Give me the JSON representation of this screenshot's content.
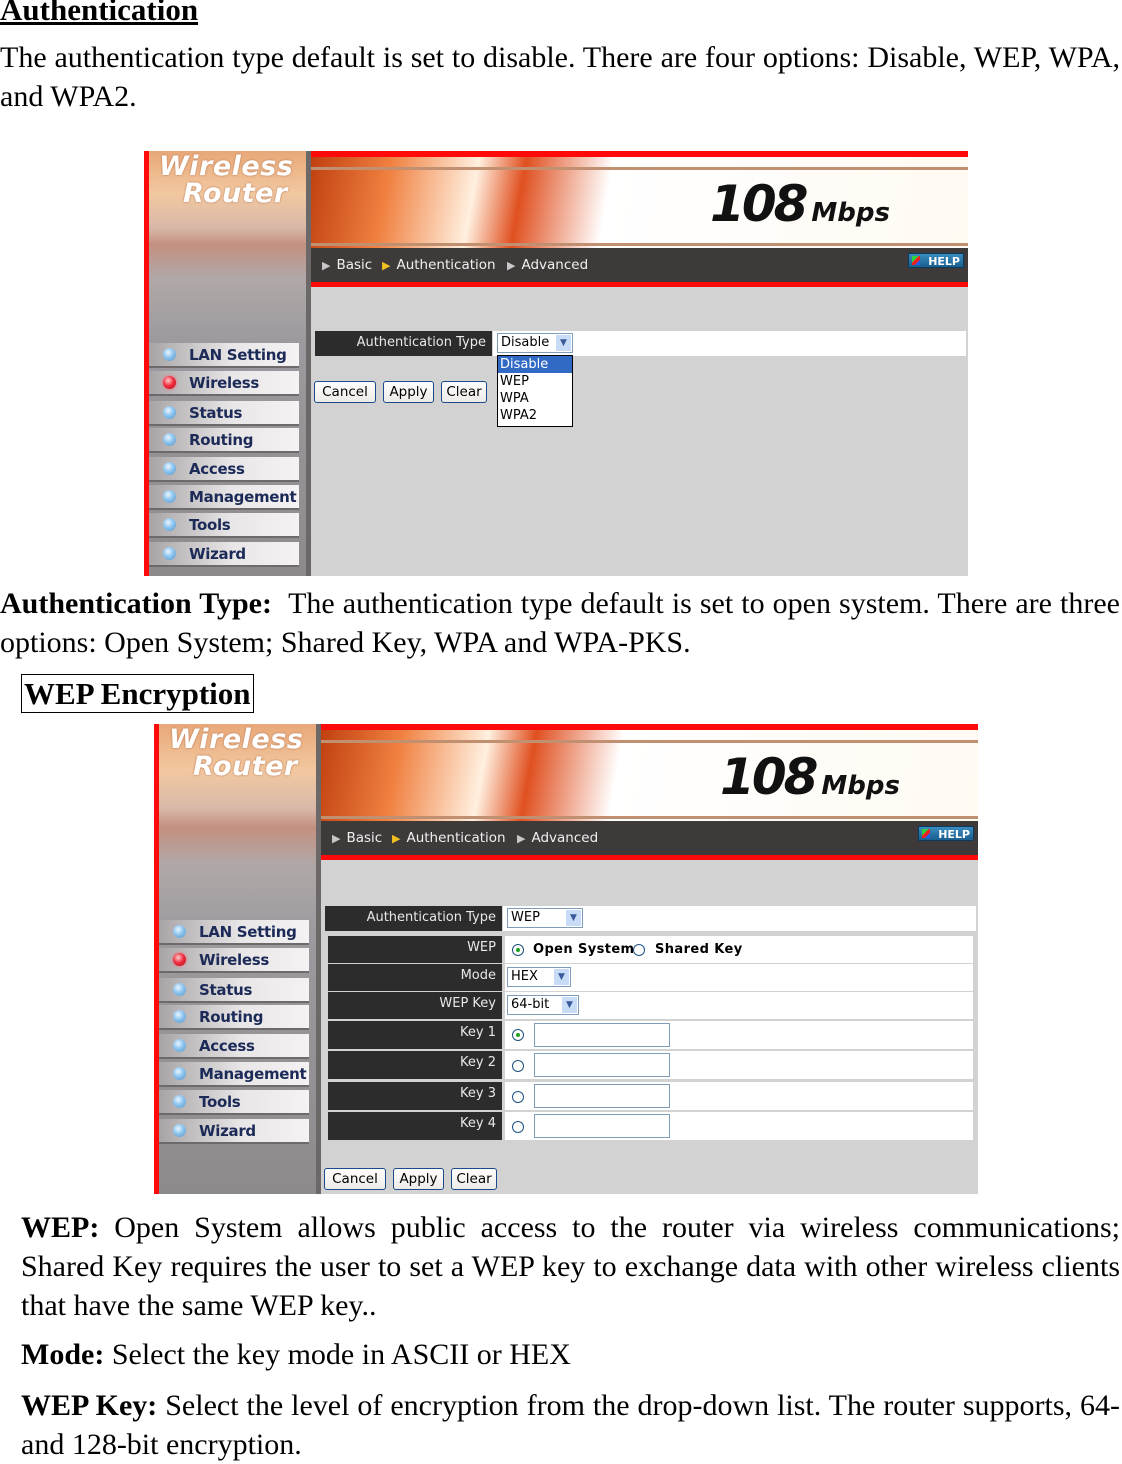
{
  "document": {
    "heading": "Authentication",
    "intro": "The authentication type default is set to disable. There are four options: Disable, WEP, WPA, and WPA2.",
    "auth_type_label": "Authentication Type:",
    "auth_type_text": "The authentication type default is set to open system. There are three options: Open System; Shared Key, WPA and WPA-PKS.",
    "wep_encryption_heading": "WEP Encryption",
    "wep_label": "WEP:",
    "wep_text": "Open System allows public access to the router via wireless communications; Shared Key requires the user to set a WEP key to exchange data with other wireless clients that have the same WEP key..",
    "mode_label": "Mode:",
    "mode_text": "Select the key mode in ASCII or HEX",
    "wepkey_label": "WEP Key:",
    "wepkey_text": "Select the level of encryption from the drop-down list. The router supports, 64- and 128-bit encryption."
  },
  "router_ui": {
    "logo_line1": "Wireless",
    "logo_line2": "Router",
    "brand": "108",
    "brand_unit": "Mbps",
    "nav": [
      "Basic",
      "Authentication",
      "Advanced"
    ],
    "help_label": "HELP",
    "menu": [
      "LAN Setting",
      "Wireless",
      "Status",
      "Routing",
      "Access",
      "Management",
      "Tools",
      "Wizard"
    ],
    "active_menu": "Wireless",
    "buttons": {
      "cancel": "Cancel",
      "apply": "Apply",
      "clear": "Clear"
    },
    "accent_color": "#ff0a0a"
  },
  "screenshot1": {
    "auth_type_label": "Authentication Type",
    "auth_type_value": "Disable",
    "dropdown_options": [
      "Disable",
      "WEP",
      "WPA",
      "WPA2"
    ],
    "dropdown_selected": "Disable"
  },
  "screenshot2": {
    "auth_type_label": "Authentication Type",
    "auth_type_value": "WEP",
    "wep_label": "WEP",
    "wep_options": [
      "Open System",
      "Shared Key"
    ],
    "wep_selected": "Open System",
    "mode_label": "Mode",
    "mode_value": "HEX",
    "wep_key_label": "WEP Key",
    "wep_key_value": "64-bit",
    "keys": [
      {
        "label": "Key 1",
        "value": "",
        "selected": true
      },
      {
        "label": "Key 2",
        "value": "",
        "selected": false
      },
      {
        "label": "Key 3",
        "value": "",
        "selected": false
      },
      {
        "label": "Key 4",
        "value": "",
        "selected": false
      }
    ]
  }
}
